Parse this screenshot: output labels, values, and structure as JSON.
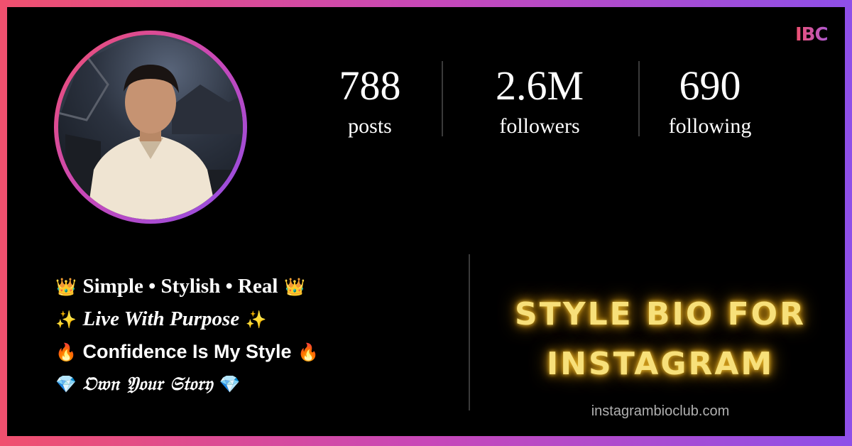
{
  "brand": {
    "logo_text": "IBC"
  },
  "profile": {
    "avatar_alt": "profile-photo",
    "stats": [
      {
        "value": "788",
        "label": "posts"
      },
      {
        "value": "2.6M",
        "label": "followers"
      },
      {
        "value": "690",
        "label": "following"
      }
    ]
  },
  "bio": {
    "lines": [
      {
        "emoji": "👑",
        "text": "Simple • Stylish • Real"
      },
      {
        "emoji": "✨",
        "text": "Live With Purpose"
      },
      {
        "emoji": "🔥",
        "text": "Confidence Is My Style"
      },
      {
        "emoji": "💎",
        "text": "𝔒𝔴𝔫 𝔜𝔬𝔲𝔯 𝔖𝔱𝔬𝔯𝔶"
      }
    ]
  },
  "headline": {
    "line1": "STYLE BIO FOR",
    "line2": "INSTAGRAM"
  },
  "footer": {
    "site": "instagrambioclub.com"
  },
  "colors": {
    "gradient_start": "#f0506e",
    "gradient_end": "#8e4fe8",
    "glow": "#f7e07a"
  }
}
